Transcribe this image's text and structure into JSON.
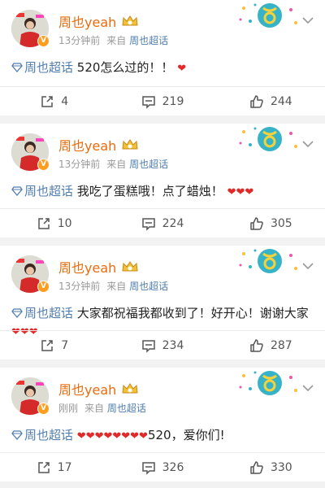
{
  "posts": [
    {
      "user": "周也yeah",
      "time": "13分钟前",
      "source_prefix": "来自",
      "source": "周也超话",
      "topic": "周也超话",
      "text": "520怎么过的！！",
      "hearts": "❤",
      "repost": "4",
      "comments": "219",
      "likes": "244"
    },
    {
      "user": "周也yeah",
      "time": "13分钟前",
      "source_prefix": "来自",
      "source": "周也超话",
      "topic": "周也超话",
      "text": "我吃了蛋糕哦！点了蜡烛！",
      "hearts": "❤❤❤",
      "repost": "10",
      "comments": "224",
      "likes": "305"
    },
    {
      "user": "周也yeah",
      "time": "13分钟前",
      "source_prefix": "来自",
      "source": "周也超话",
      "topic": "周也超话",
      "text": "大家都祝福我都收到了！好开心！谢谢大家",
      "hearts": "❤❤❤",
      "repost": "7",
      "comments": "234",
      "likes": "287"
    },
    {
      "user": "周也yeah",
      "time": "刚刚",
      "source_prefix": "来自",
      "source": "周也超话",
      "topic": "周也超话",
      "text_before": "❤❤❤❤❤❤❤❤",
      "text": "520，爱你们!",
      "repost": "17",
      "comments": "326",
      "likes": "330"
    }
  ],
  "colors": {
    "accent_name": "#e86b0e",
    "link": "#507daf",
    "heart": "#e02a2a"
  },
  "icons": {
    "repost": "share-icon",
    "comment": "comment-icon",
    "like": "thumbs-up-icon",
    "topic": "diamond-icon",
    "badge": "crown-icon",
    "decoration": "taurus-sign-icon",
    "menu": "chevron-down-icon"
  }
}
